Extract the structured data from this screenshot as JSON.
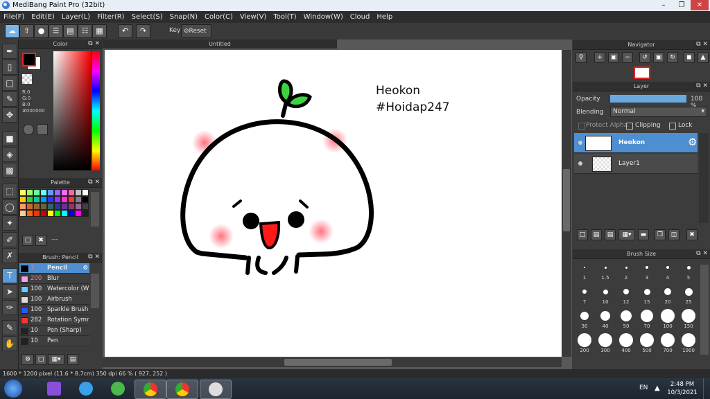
{
  "window": {
    "title": "MediBang Paint Pro (32bit)"
  },
  "menu": [
    "File(F)",
    "Edit(E)",
    "Layer(L)",
    "Filter(R)",
    "Select(S)",
    "Snap(N)",
    "Color(C)",
    "View(V)",
    "Tool(T)",
    "Window(W)",
    "Cloud",
    "Help"
  ],
  "toolbar": {
    "key_label": "Key",
    "reset_label": "Reset"
  },
  "color_panel": {
    "title": "Color",
    "r": "R:0",
    "g": "G:0",
    "b": "B:0",
    "hex": "#000000",
    "fg_color": "#000000",
    "bg_color": "#ffffff"
  },
  "palette_panel": {
    "title": "Palette",
    "dash": "---",
    "swatches": [
      "#ffff66",
      "#99ff66",
      "#66ff99",
      "#66ffff",
      "#6699ff",
      "#9966ff",
      "#ff66ff",
      "#ff6699",
      "#c0c0c0",
      "#ffffff",
      "#ffcc00",
      "#33cc33",
      "#00cc99",
      "#0099ff",
      "#3333ff",
      "#9933ff",
      "#ff33cc",
      "#ff3333",
      "#808080",
      "#000000",
      "#ff9966",
      "#cc6633",
      "#996633",
      "#666633",
      "#336666",
      "#333399",
      "#663399",
      "#993366",
      "#996699",
      "#404040",
      "#ffcc99",
      "#ff6600",
      "#ff3300",
      "#cc0000",
      "#ffff00",
      "#00ff00",
      "#00ffff",
      "#0000ff",
      "#ff00ff",
      "#202020"
    ]
  },
  "brush_panel": {
    "title": "Brush: Pencil",
    "brushes": [
      {
        "size": "7",
        "name": "Pencil",
        "color": "#000000"
      },
      {
        "size": "200",
        "name": "Blur",
        "color": "#f0a0f0"
      },
      {
        "size": "100",
        "name": "Watercolor (W",
        "color": "#66ccff"
      },
      {
        "size": "100",
        "name": "Airbrush",
        "color": "#dddddd"
      },
      {
        "size": "100",
        "name": "Sparkle Brush",
        "color": "#3355ff"
      },
      {
        "size": "282",
        "name": "Rotation Symm",
        "color": "#ff3333"
      },
      {
        "size": "10",
        "name": "Pen (Sharp)",
        "color": "#222222"
      },
      {
        "size": "10",
        "name": "Pen",
        "color": "#222222"
      }
    ]
  },
  "document": {
    "tab": "Untitled",
    "text_line1": "Heokon",
    "text_line2": "#Hoidap247"
  },
  "navigator": {
    "title": "Navigator"
  },
  "layer_panel": {
    "title": "Layer",
    "opacity_label": "Opacity",
    "opacity_value": "100",
    "opacity_unit": "%",
    "opacity_fraction": 1.0,
    "blending_label": "Blending",
    "blending_value": "Normal",
    "protect_alpha": "Protect Alpha",
    "clipping": "Clipping",
    "lock": "Lock",
    "layers": [
      {
        "name": "Heokon",
        "selected": true
      },
      {
        "name": "Layer1",
        "selected": false
      }
    ]
  },
  "brush_size_panel": {
    "title": "Brush Size",
    "sizes": [
      "1",
      "1.5",
      "2",
      "3",
      "4",
      "5",
      "7",
      "10",
      "12",
      "15",
      "20",
      "25",
      "30",
      "40",
      "50",
      "70",
      "100",
      "150",
      "200",
      "300",
      "400",
      "500",
      "700",
      "1000"
    ]
  },
  "status": {
    "dimensions": "1600 * 1200 pixel",
    "physical": "(11.6 * 8.7cm)",
    "dpi": "350 dpi",
    "zoom": "66 %",
    "coords": "( 927, 252 )"
  },
  "taskbar": {
    "lang": "EN",
    "time": "2:48 PM",
    "date": "10/3/2021"
  }
}
